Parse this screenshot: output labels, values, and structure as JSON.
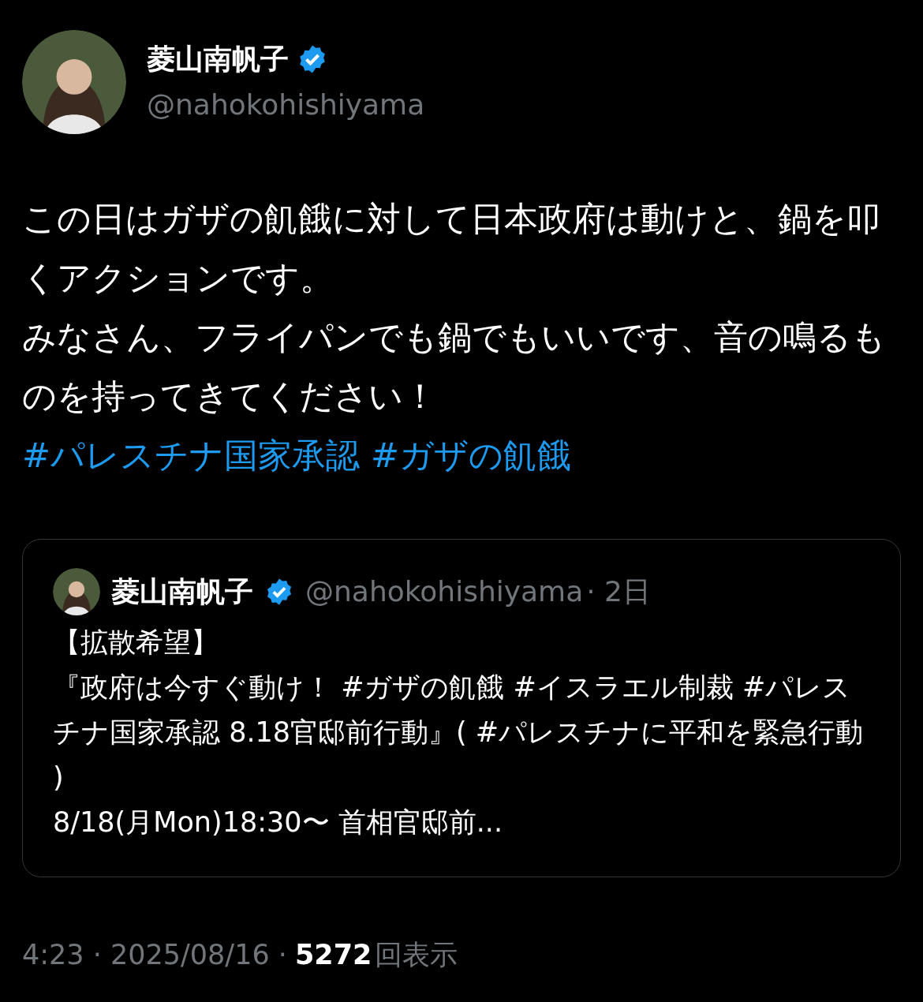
{
  "author": {
    "name": "菱山南帆子",
    "handle": "@nahokohishiyama",
    "verified": true
  },
  "body": [
    "この日はガザの飢餓に対して日本政府は動けと、鍋を叩くアクションです。",
    "みなさん、フライパンでも鍋でもいいです、音の鳴るものを持ってきてください！"
  ],
  "hashtags": [
    "#パレスチナ国家承認",
    "#ガザの飢餓"
  ],
  "quote": {
    "name": "菱山南帆子",
    "verified": true,
    "handle": "@nahokohishiyama",
    "time": "· 2日",
    "lines": [
      "【拡散希望】",
      "『政府は今すぐ動け！ #ガザの飢餓 #イスラエル制裁 #パレスチナ国家承認 8.18官邸前行動』( #パレスチナに平和を緊急行動 )",
      "8/18(月Mon)18:30〜 首相官邸前..."
    ]
  },
  "footer": {
    "time": "4:23 · 2025/08/16 ·",
    "views": "5272",
    "views_label": "回表示"
  }
}
